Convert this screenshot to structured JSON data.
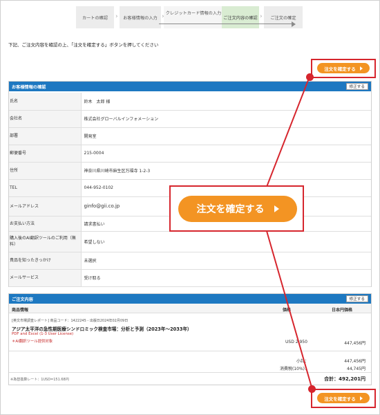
{
  "steps": [
    {
      "label": "カートの確認",
      "active": false
    },
    {
      "label": "お客様情報の入力",
      "active": false
    },
    {
      "label": "クレジットカード情報の入力",
      "active": false
    },
    {
      "label": "ご注文内容の確認",
      "active": true
    },
    {
      "label": "ご注文の確定",
      "active": false
    }
  ],
  "instruction": "下記、ご注文内容を確認の上、「注文を確定する」ボタンを押してください",
  "confirm_label": "注文を確定する",
  "customer": {
    "title": "お客様情報の確認",
    "edit_label": "修正する",
    "rows": [
      {
        "label": "氏名",
        "value": "鈴木　太郎 様"
      },
      {
        "label": "会社名",
        "value": "株式会社グローバルインフォメーション"
      },
      {
        "label": "部署",
        "value": "開発室"
      },
      {
        "label": "郵便番号",
        "value": "215-0004"
      },
      {
        "label": "住所",
        "value": "神奈川県川崎市麻生区万福寺 1-2-3"
      },
      {
        "label": "TEL",
        "value": "044-952-0102"
      },
      {
        "label": "メールアドレス",
        "value": "ginfo@gii.co.jp"
      },
      {
        "label": "お支払い方法",
        "value": "請求書払い"
      },
      {
        "label": "購入後のAI翻訳ツールのご利用（無料）",
        "value": "希望しない"
      },
      {
        "label": "貴品を知ったきっかけ",
        "value": "未選択"
      },
      {
        "label": "メールサービス",
        "value": "受け取る"
      }
    ]
  },
  "order": {
    "title": "ご注文内容",
    "edit_label": "修正する",
    "col_product": "商品情報",
    "col_price": "価格",
    "col_jpy": "日本円価格",
    "product_meta": "[英文市場調査レポート] 商品コード：1422245 - 出版日2024年02月09日",
    "product_title": "アジア太平洋の急性期医療シンドロミック検査市場：分析と予測（2023年～2033年）",
    "product_format": "PDF and Excel (1-3 User License)",
    "product_note": "＊AI翻訳ツール提供対象",
    "price": "USD 2,950",
    "jpy_price": "447,456円",
    "subtotal_label": "小計：",
    "subtotal": "447,456円",
    "tax_label": "消費税(10%)：",
    "tax": "44,745円",
    "rate_note": "※為替換算レート：1USD=151.68円",
    "total": "合計：492,201円"
  },
  "colors": {
    "accent": "#f39423",
    "header": "#1d78c1",
    "highlight": "#d6252d",
    "active_step": "#d9ecd2"
  }
}
